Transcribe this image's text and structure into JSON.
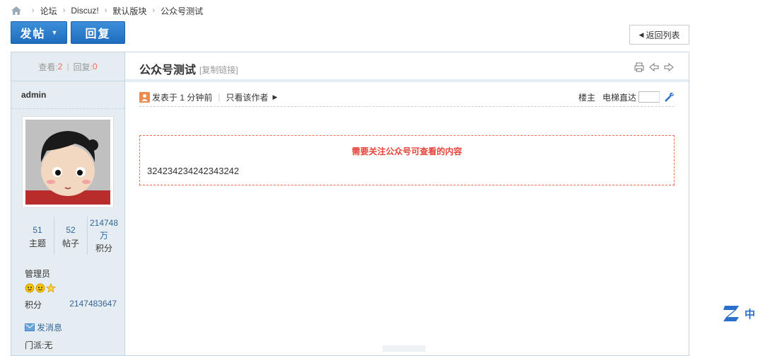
{
  "breadcrumb": {
    "items": [
      "论坛",
      "Discuz!",
      "默认版块",
      "公众号测试"
    ],
    "separator": "›"
  },
  "toolbar": {
    "post_label": "发帖",
    "reply_label": "回复",
    "back_label": "返回列表"
  },
  "sidebar": {
    "views_label": "查看:",
    "views": "2",
    "replies_label": "回复:",
    "replies": "0",
    "username": "admin",
    "stats": [
      {
        "value": "51",
        "label": "主题"
      },
      {
        "value": "52",
        "label": "帖子"
      },
      {
        "value": "214748万",
        "label": "积分"
      }
    ],
    "group": "管理员",
    "points_label": "积分",
    "points_value": "2147483647",
    "message_label": "发消息",
    "menpai": "门派:无"
  },
  "post": {
    "title": "公众号测试",
    "copy_link": "[复制链接]",
    "posted_at": "发表于 1 分钟前",
    "only_author": "只看该作者",
    "floor_label": "楼主",
    "jump_label": "电梯直达",
    "notice": "需要关注公众号可查看的内容",
    "body": "324234234242343242"
  },
  "floating_widget": {
    "label": "中"
  },
  "colors": {
    "accent_blue": "#1f6dbf",
    "sidebar_bg": "#e5edf2",
    "notice_red": "#e8443a",
    "link_blue": "#336699"
  }
}
